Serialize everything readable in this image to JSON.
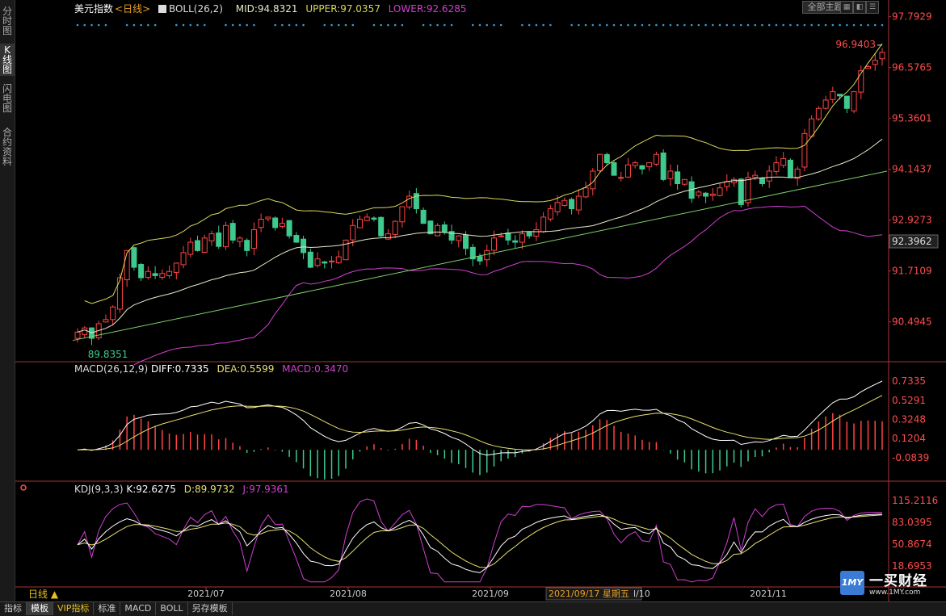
{
  "sidebar": {
    "tabs": [
      "分时图",
      "K线图",
      "闪电图",
      "合约资料"
    ],
    "active": 1
  },
  "main_header": {
    "name": "美元指数",
    "period_tag": "<日线>",
    "boll_label": "BOLL(26,2)",
    "mid": "MID:94.8321",
    "upper": "UPPER:97.0357",
    "lower": "LOWER:92.6285"
  },
  "macd_header": {
    "label": "MACD(26,12,9)",
    "diff": "DIFF:0.7335",
    "dea": "DEA:0.5599",
    "macd": "MACD:0.3470"
  },
  "kdj_header": {
    "label": "KDJ(9,3,3)",
    "k": "K:92.6275",
    "d": "D:89.9732",
    "j": "J:97.9361"
  },
  "top_buttons": {
    "template": "全部主题▼"
  },
  "annotations": {
    "high": "96.9403",
    "low": "89.8351",
    "current_price": "92.3962",
    "cursor_date": "2021/09/17 星期五",
    "cursor_extra": "l/10"
  },
  "x_axis": {
    "period_button": "日线 ▲",
    "months": [
      "2021/07",
      "2021/08",
      "2021/09",
      "2021/11"
    ]
  },
  "bottom_tabs": [
    "指标",
    "模板",
    "VIP指标",
    "标准",
    "MACD",
    "BOLL",
    "另存模板"
  ],
  "logo": {
    "badge": "1MY",
    "name": "一买财经",
    "url": "www.1MY.com"
  },
  "colors": {
    "up": "#ff4444",
    "down": "#3ec98e",
    "mid": "#e8e8c8",
    "upper": "#d8d85a",
    "lower": "#d040d0",
    "trend": "#7fd16a",
    "dea": "#e8e070",
    "diff": "#ffffff"
  },
  "chart_data": [
    {
      "type": "candlestick",
      "title": "美元指数",
      "y_ticks": [
        97.7929,
        96.5765,
        95.3601,
        94.1437,
        92.9273,
        91.7109,
        90.4945
      ],
      "ylim": [
        89.6,
        98.0
      ],
      "high": 96.9403,
      "low": 89.8351,
      "last_close": 96.9403,
      "x_ticks": [
        "2021/07",
        "2021/08",
        "2021/09",
        "2021/11"
      ],
      "indicators": {
        "BOLL": {
          "mid": 94.8321,
          "upper": 97.0357,
          "lower": 92.6285
        }
      },
      "closes": [
        90.25,
        90.35,
        90.1,
        90.45,
        90.55,
        90.85,
        91.55,
        92.2,
        91.8,
        91.55,
        91.7,
        91.6,
        91.65,
        91.7,
        91.9,
        92.15,
        92.4,
        92.2,
        92.5,
        92.6,
        92.3,
        92.8,
        92.45,
        92.5,
        92.2,
        92.7,
        92.95,
        93.0,
        92.75,
        92.85,
        92.55,
        92.4,
        92.15,
        91.8,
        92.0,
        91.9,
        91.95,
        92.05,
        92.45,
        92.8,
        92.95,
        93.0,
        92.95,
        92.55,
        92.6,
        92.9,
        93.25,
        93.5,
        93.2,
        92.85,
        92.6,
        92.8,
        92.65,
        92.45,
        92.55,
        92.25,
        92.0,
        91.95,
        92.2,
        92.5,
        92.55,
        92.45,
        92.4,
        92.6,
        92.55,
        92.7,
        93.0,
        93.2,
        93.35,
        93.4,
        93.2,
        93.5,
        93.7,
        94.1,
        94.5,
        94.3,
        94.0,
        93.95,
        94.25,
        94.3,
        94.15,
        94.3,
        94.5,
        93.9,
        94.1,
        93.8,
        93.9,
        93.45,
        93.6,
        93.5,
        93.55,
        93.7,
        93.85,
        93.9,
        93.3,
        93.95,
        94.0,
        93.8,
        94.1,
        94.3,
        94.4,
        93.95,
        94.15,
        95.0,
        95.35,
        95.6,
        95.8,
        96.0,
        95.9,
        95.6,
        96.0,
        96.5,
        96.6,
        96.75,
        96.9403
      ]
    },
    {
      "type": "bar+line",
      "title": "MACD(26,12,9)",
      "y_ticks": [
        0.7335,
        0.5291,
        0.3248,
        0.1204,
        -0.0839
      ],
      "ylim": [
        -0.3,
        0.82
      ],
      "series": [
        {
          "name": "DIFF",
          "last": 0.7335
        },
        {
          "name": "DEA",
          "last": 0.5599
        },
        {
          "name": "MACD",
          "last": 0.347
        }
      ]
    },
    {
      "type": "line",
      "title": "KDJ(9,3,3)",
      "y_ticks": [
        115.2116,
        83.0395,
        50.8674,
        18.6953
      ],
      "ylim": [
        -10,
        125
      ],
      "series": [
        {
          "name": "K",
          "last": 92.6275
        },
        {
          "name": "D",
          "last": 89.9732
        },
        {
          "name": "J",
          "last": 97.9361
        }
      ]
    }
  ]
}
